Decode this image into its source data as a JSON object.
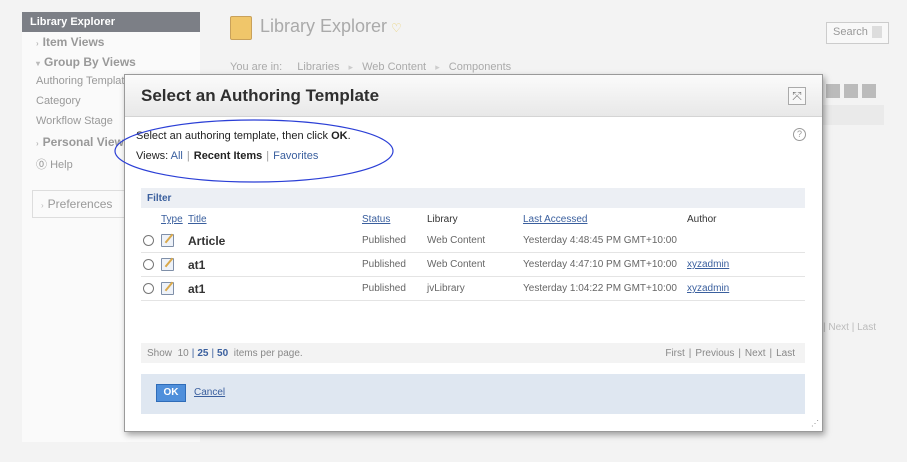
{
  "sidebar": {
    "active": "Library Explorer",
    "item_views": "Item Views",
    "group_by_views": "Group By Views",
    "authoring_templates": "Authoring Templates",
    "category": "Category",
    "workflow_stage": "Workflow Stage",
    "personal_views": "Personal Views",
    "help": "Help",
    "preferences": "Preferences"
  },
  "header": {
    "title": "Library Explorer",
    "breadcrumb_prefix": "You are in:",
    "breadcrumbs": [
      "Libraries",
      "Web Content",
      "Components"
    ],
    "search_label": "Search"
  },
  "background_pager": {
    "next": "Next",
    "last": "Last"
  },
  "modal": {
    "title": "Select an Authoring Template",
    "close_glyph": "⤧",
    "instruction_prefix": "Select an authoring template, then click ",
    "instruction_ok": "OK",
    "instruction_suffix": ".",
    "views_label": "Views:",
    "views_all": "All",
    "views_recent": "Recent Items",
    "views_favorites": "Favorites",
    "help_glyph": "?",
    "filter_label": "Filter",
    "columns": {
      "type": "Type",
      "title": "Title",
      "status": "Status",
      "library": "Library",
      "last_accessed": "Last Accessed",
      "author": "Author"
    },
    "rows": [
      {
        "title": "Article",
        "status": "Published",
        "library": "Web Content",
        "last_accessed": "Yesterday 4:48:45 PM GMT+10:00",
        "author": ""
      },
      {
        "title": "at1",
        "status": "Published",
        "library": "Web Content",
        "last_accessed": "Yesterday 4:47:10 PM GMT+10:00",
        "author": "xyzadmin"
      },
      {
        "title": "at1",
        "status": "Published",
        "library": "jvLibrary",
        "last_accessed": "Yesterday 1:04:22 PM GMT+10:00",
        "author": "xyzadmin"
      }
    ],
    "pager": {
      "show": "Show",
      "sizes": [
        "10",
        "25",
        "50"
      ],
      "suffix": "items per page.",
      "first": "First",
      "previous": "Previous",
      "next": "Next",
      "last": "Last"
    },
    "ok_label": "OK",
    "cancel_label": "Cancel"
  },
  "colors": {
    "accent": "#3a5f9e",
    "annotation": "#2b3fd6",
    "ok_button": "#4f8fdb"
  }
}
